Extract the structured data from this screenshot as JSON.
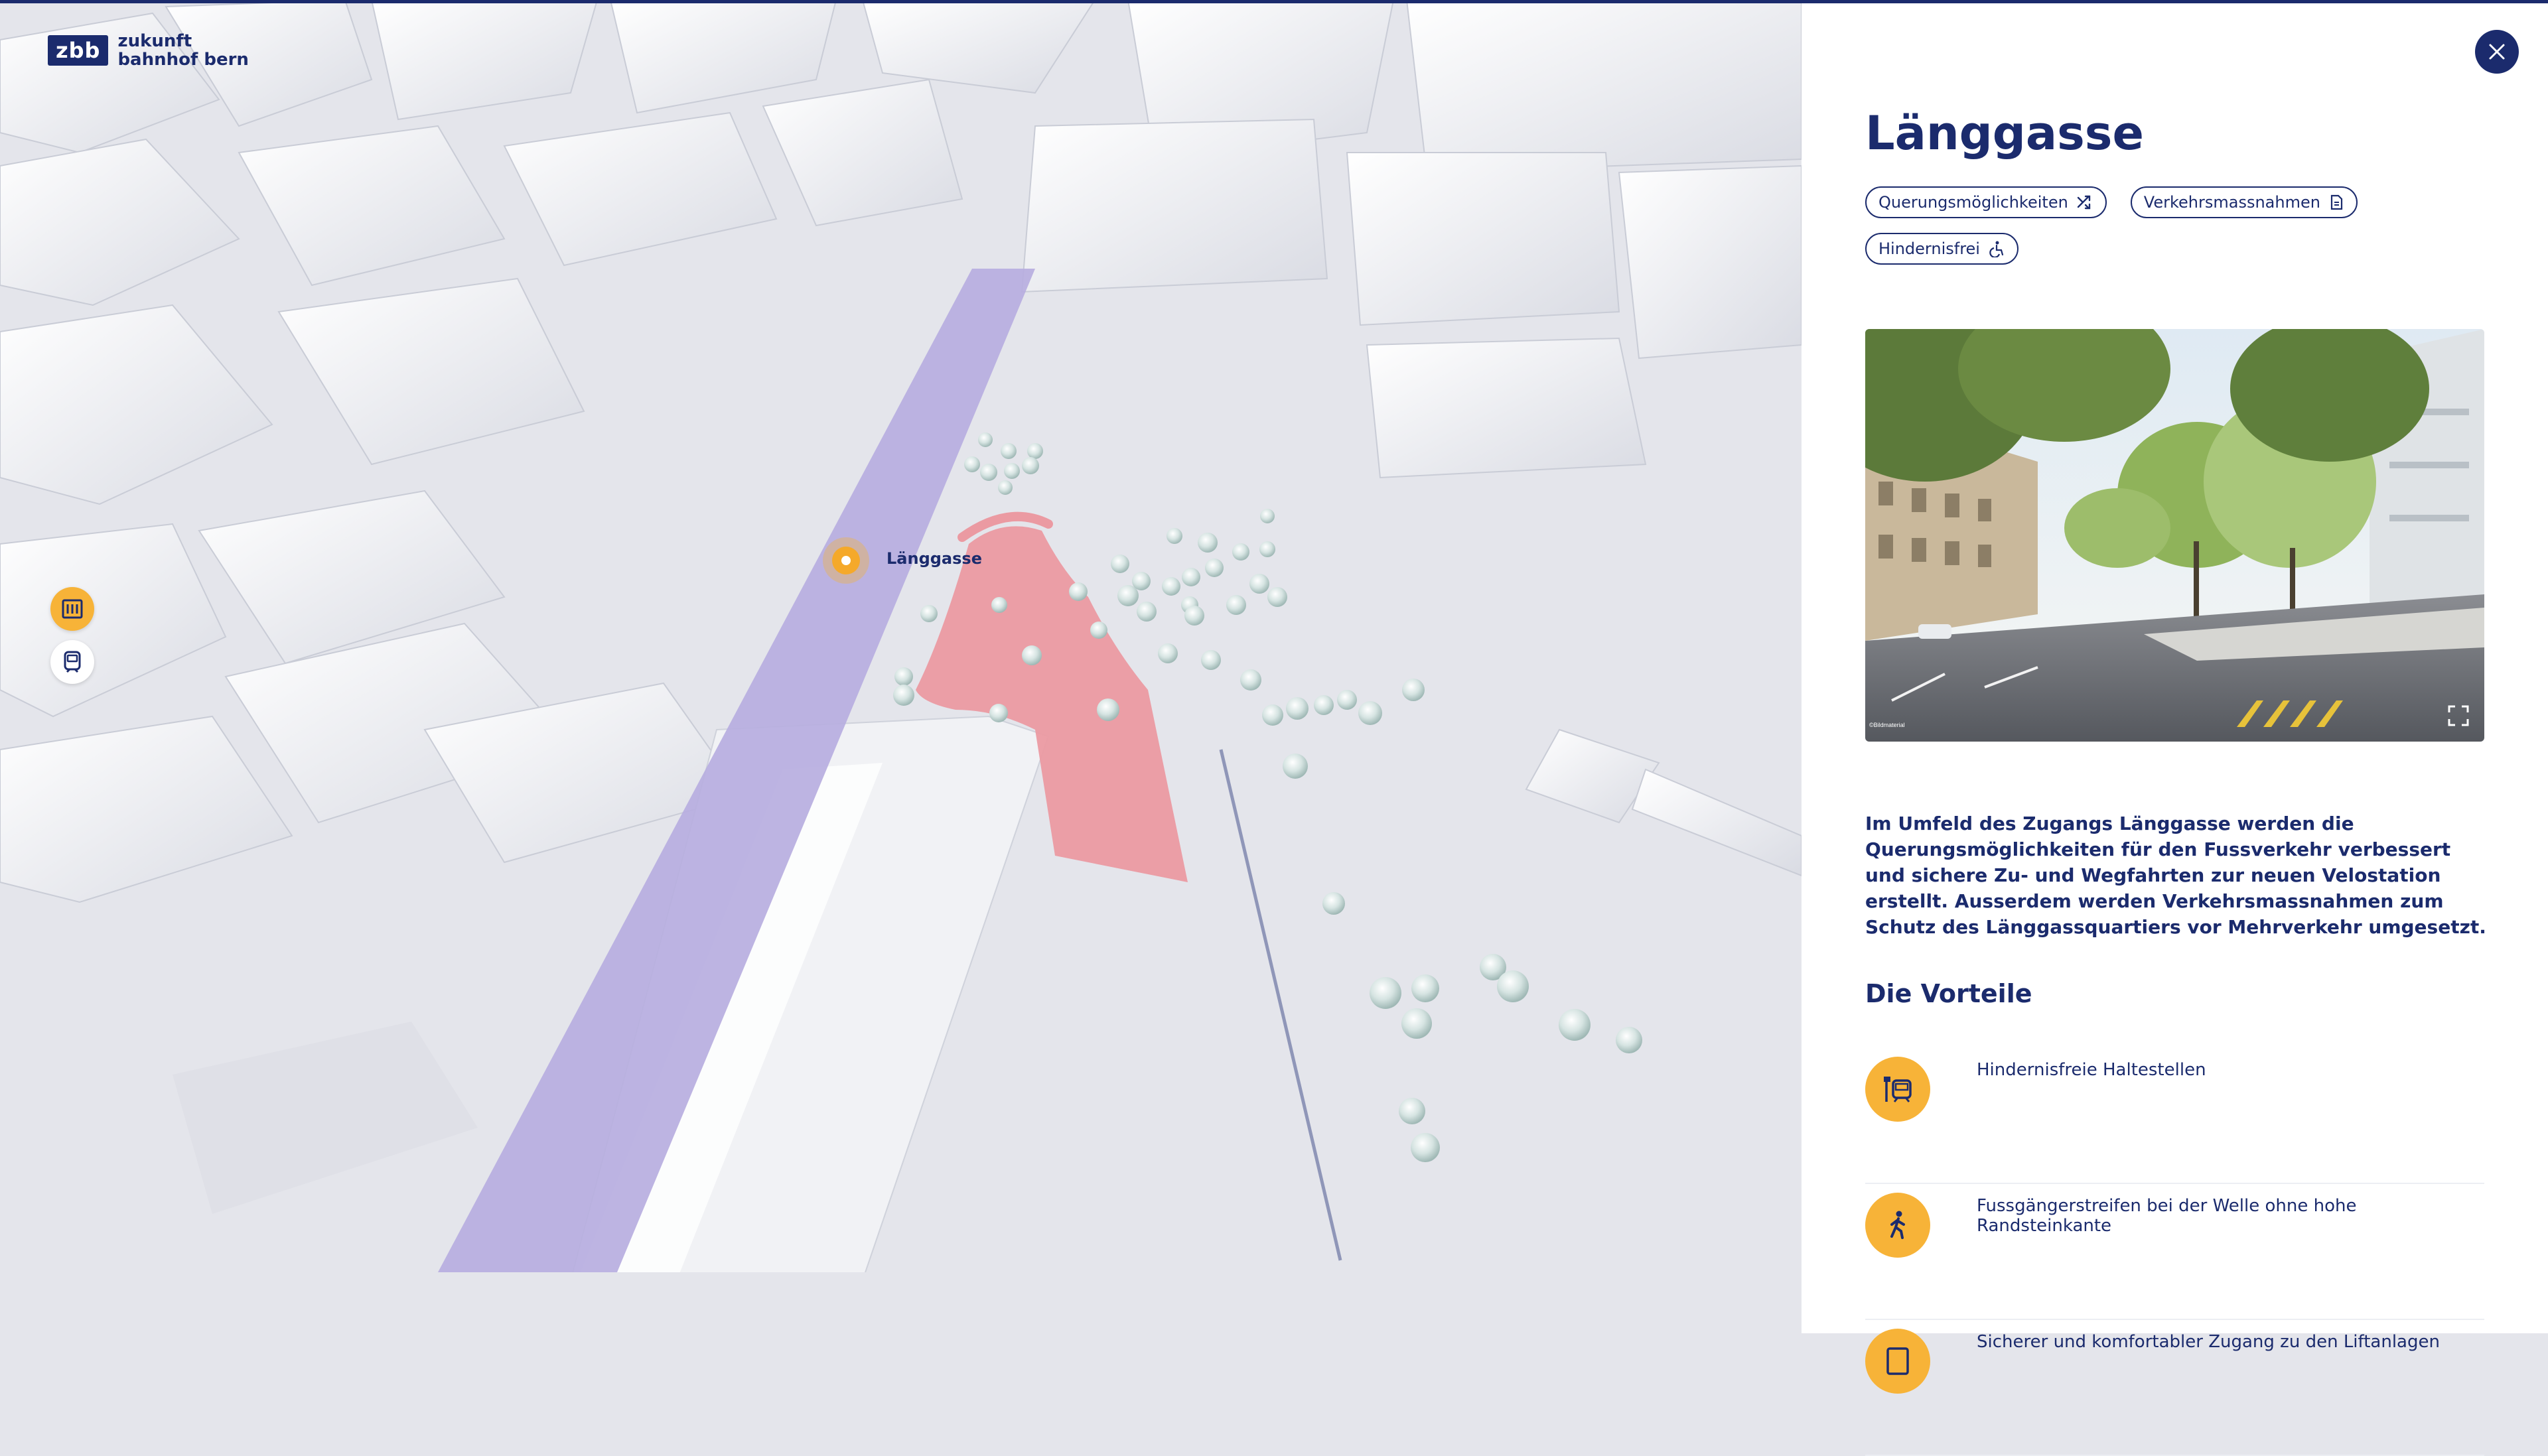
{
  "brand": {
    "mark": "zbb",
    "line1": "zukunft",
    "line2": "bahnhof bern"
  },
  "map": {
    "marker_label": "Länggasse",
    "layers": [
      {
        "icon": "building-icon",
        "active": true
      },
      {
        "icon": "tram-icon",
        "active": false
      }
    ]
  },
  "panel": {
    "title": "Länggasse",
    "tags": [
      {
        "label": "Querungsmöglichkeiten",
        "icon": "shuffle-icon"
      },
      {
        "label": "Verkehrsmassnahmen",
        "icon": "document-icon"
      },
      {
        "label": "Hindernisfrei",
        "icon": "wheelchair-icon"
      }
    ],
    "image": {
      "credit": "©Bildmaterial",
      "action": "expand-icon"
    },
    "description": "Im Umfeld des Zugangs Länggasse werden die Querungsmöglichkeiten für den Fussverkehr verbessert und sichere Zu- und Wegfahrten zur neuen Velostation erstellt. Ausserdem werden Verkehrsmassnahmen zum Schutz des Länggassquartiers vor Mehrverkehr umgesetzt.",
    "benefits_title": "Die Vorteile",
    "benefits": [
      {
        "text": "Hindernisfreie Haltestellen",
        "icon": "tram-stop-icon"
      },
      {
        "text": "Fussgängerstreifen bei der Welle ohne hohe Randsteinkante",
        "icon": "pedestrian-icon"
      },
      {
        "text": "Sicherer und komfortabler Zugang zu den Liftanlagen",
        "icon": "elevator-icon"
      }
    ]
  },
  "colors": {
    "brand": "#1b2b6d",
    "accent": "#f7b338",
    "route": "#b7aee0",
    "area": "#ec9ca4"
  }
}
